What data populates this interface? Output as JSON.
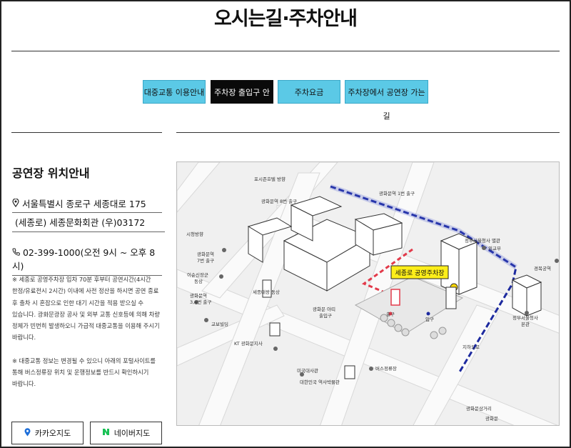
{
  "page": {
    "title": "오시는길·주차안내"
  },
  "tabs": [
    {
      "label": "대중교통 이용안내",
      "active": false
    },
    {
      "label": "주차장 출입구 안내",
      "active": true
    },
    {
      "label": "주차요금",
      "active": false
    },
    {
      "label": "주차장에서 공연장 가는 길",
      "active": false
    }
  ],
  "location": {
    "heading": "공연장 위치안내",
    "address_line1": "서울특별시 종로구 세종대로 175",
    "address_line2": "(세종로) 세종문화회관 (우)03172",
    "phone": "02-399-1000(오전 9시 ~ 오후 8시)",
    "notes": [
      "※ 세종로 공영주차장 입차 70분 후부터 공연시간(4시간",
      "한정/유료전시 2시간) 이내에 사전 정산을 하시면 공연 종료",
      "후 출차 시 혼잡으로 인한 대기 시간을 적용 받으실 수",
      "있습니다. 광화문광장 공사 및 외부 교통 신호등에 의해 차량",
      "정체가 빈번히 발생하오니 가급적 대중교통을 이용해 주시기",
      "바랍니다.",
      "",
      "※ 대중교통 정보는 변경될 수 있으니 아래의 포털사이트를",
      "통해 버스정류장 위치 및 운행정보를 반드시 확인하시기",
      "바랍니다."
    ]
  },
  "map_buttons": {
    "kakao": "카카오지도",
    "naver": "네이버지도"
  },
  "map": {
    "callout": "세종로 공영주차장",
    "labels": {
      "toshijun": "포시즌호텔 방향",
      "exit1": "광화문역 1번 출구",
      "exit8": "광화문역 8번 출구",
      "sijeong": "시청방향",
      "exit7": "광화문역\n7번 출구",
      "yisunsin": "이순신장군\n동상",
      "sejong_statue": "세종대왕 동상",
      "exit34": "광화문역\n3,4번 출구",
      "gyobo": "교보빌딩",
      "kt": "KT 광화문지사",
      "gov_annex": "정부서울청사 별관",
      "mofa": "외교부",
      "gov_main": "정부서울청사\n본관",
      "gyeongbok": "경복궁역",
      "arcade_exit": "광화문 아띠\n출입구",
      "exit_label": "출구",
      "entry_label": "입구",
      "jihadoro": "지하도로",
      "us_embassy": "미국대사관",
      "bus_stop": "버스정류장",
      "museum": "대한민국 역사박물관",
      "plaza_street": "광화문삼거리",
      "gwanghwamun": "광화문"
    }
  }
}
